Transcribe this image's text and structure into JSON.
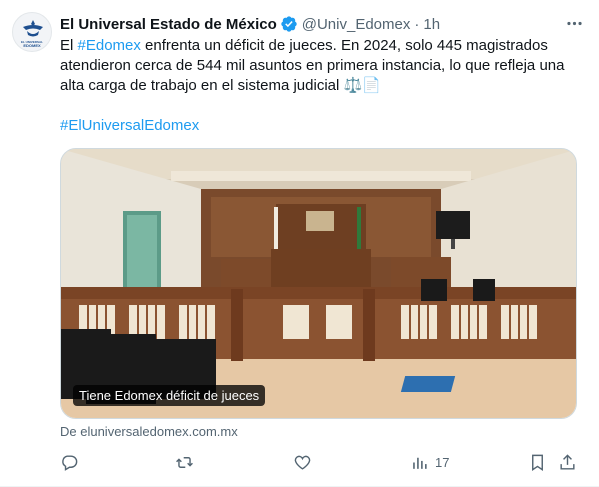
{
  "tweet": {
    "display_name": "El Universal Estado de México",
    "handle": "@Univ_Edomex",
    "separator": "·",
    "time": "1h",
    "avatar_text": {
      "line1": "EL UNIVERSAL",
      "line2": "EDOMEX"
    },
    "text": {
      "before_tag": "El ",
      "hashtag1": "#Edomex",
      "after_tag": " enfrenta un déficit de jueces. En 2024, solo 445 magistrados atendieron cerca de 544 mil asuntos en primera instancia, lo que refleja una alta carga de trabajo en el sistema judicial ⚖️📄",
      "hashtag2": "#ElUniversalEdomex"
    },
    "media": {
      "caption": "Tiene Edomex déficit de jueces"
    },
    "source": "De eluniversaledomex.com.mx",
    "actions": {
      "views_count": "17"
    }
  },
  "colors": {
    "accent": "#1d9bf0",
    "secondary_text": "#536471",
    "primary_text": "#0f1419"
  },
  "icons": [
    "verified-badge-icon",
    "more-icon",
    "reply-icon",
    "retweet-icon",
    "like-icon",
    "views-icon",
    "bookmark-icon",
    "share-icon"
  ]
}
